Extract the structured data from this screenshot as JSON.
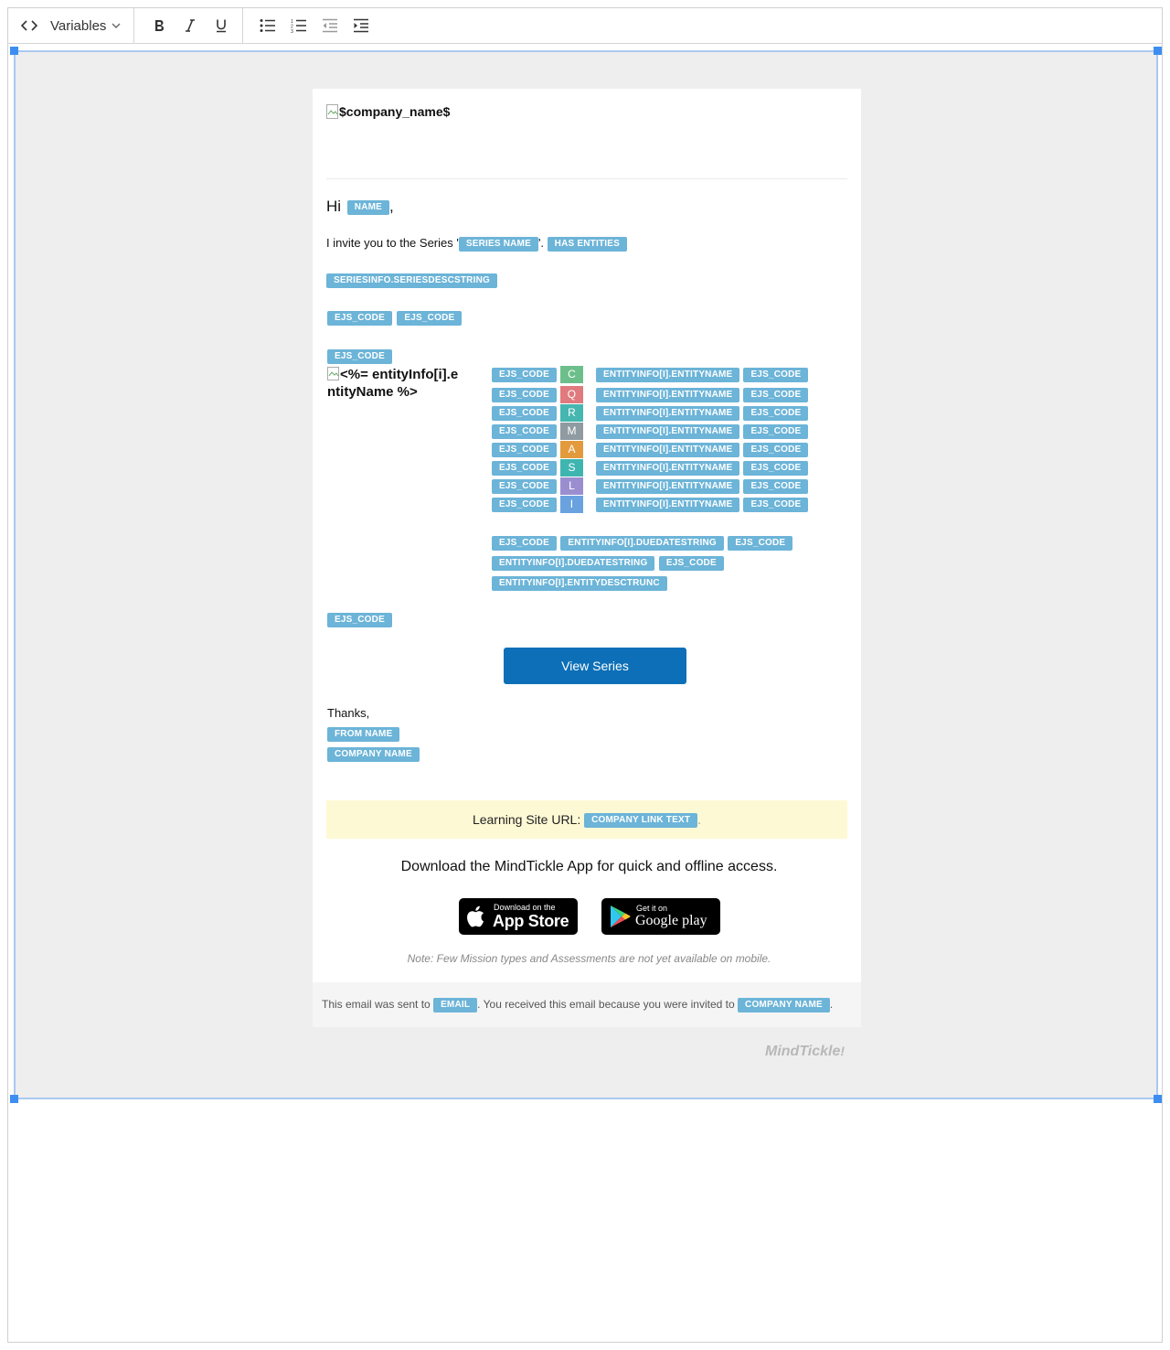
{
  "toolbar": {
    "variables_label": "Variables",
    "buttons": [
      "code-view",
      "bold",
      "italic",
      "underline",
      "bullet-list",
      "numbered-list",
      "outdent",
      "indent"
    ]
  },
  "email": {
    "logo_alt": "$company_name$",
    "greeting_prefix": "Hi",
    "greeting_suffix": ",",
    "name_var": "NAME",
    "invite_prefix": "I invite you to the Series '",
    "series_name_var": "SERIES NAME",
    "invite_suffix": "'.",
    "has_entities_var": "HAS ENTITIES",
    "series_desc_var": "SERIESINFO.SERIESDESCSTRING",
    "ejs_code": "EJS_CODE",
    "entity_image_alt": "<%= entityInfo[i].entityName %>",
    "entity_name_var": "ENTITYINFO[I].ENTITYNAME",
    "entity_letters": [
      {
        "letter": "C",
        "color": "#6cbf8a"
      },
      {
        "letter": "Q",
        "color": "#e07a7e"
      },
      {
        "letter": "R",
        "color": "#46b6b0"
      },
      {
        "letter": "M",
        "color": "#8f9aa1"
      },
      {
        "letter": "A",
        "color": "#e39a3c"
      },
      {
        "letter": "S",
        "color": "#3fb5b0"
      },
      {
        "letter": "L",
        "color": "#9b8ed0"
      },
      {
        "letter": "I",
        "color": "#6aa2e0"
      }
    ],
    "due_date_var": "ENTITYINFO[I].DUEDATESTRING",
    "entity_desc_var": "ENTITYINFO[I].ENTITYDESCTRUNC",
    "view_series_label": "View Series",
    "thanks": "Thanks,",
    "from_name_var": "FROM NAME",
    "company_name_var": "COMPANY NAME",
    "learning_site_label": "Learning Site URL:",
    "company_link_var": "COMPANY LINK TEXT",
    "learning_site_suffix": ".",
    "download_text": "Download the MindTickle App for quick and offline access.",
    "app_store_small": "Download on the",
    "app_store_big": "App Store",
    "google_small": "Get it on",
    "google_big": "Google play",
    "note": "Note: Few Mission types and Assessments are not yet available on mobile.",
    "footer_prefix": "This email was sent to",
    "email_var": "EMAIL",
    "footer_middle": ". You received this email because you were invited to",
    "footer_suffix": ".",
    "brand": "MindTickle"
  },
  "colors": {
    "pill": "#6cb4d8",
    "button": "#0c6fb7",
    "banner": "#fef9d5",
    "canvas": "#eeeeee",
    "selection": "#3d8ef0"
  }
}
